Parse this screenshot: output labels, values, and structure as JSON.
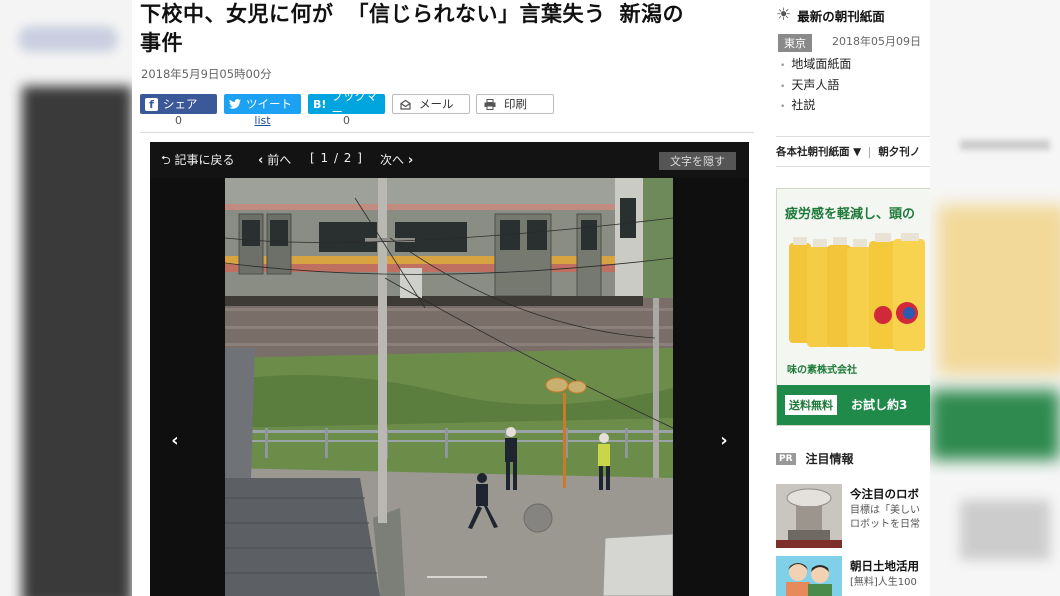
{
  "article": {
    "headline_part1": "下校中、女児に何が",
    "headline_part2": "「信じられない」言葉失う",
    "headline_part3": "新潟の",
    "headline_line2": "事件",
    "dateline": "2018年5月9日05時00分"
  },
  "share": {
    "facebook": {
      "icon": "f",
      "label": "シェア",
      "count": "0"
    },
    "twitter": {
      "label": "ツイート",
      "count": "list"
    },
    "hatena": {
      "icon": "B!",
      "label": "ブックマー",
      "count": "0"
    },
    "mail": {
      "label": "メール"
    },
    "print": {
      "label": "印刷"
    }
  },
  "viewer": {
    "back_label": "記事に戻る",
    "prev_label": "前へ",
    "page_indicator": "[ 1 / 2 ]",
    "next_label": "次へ",
    "hide_text_label": "文字を隠す"
  },
  "sidebar": {
    "section_title": "最新の朝刊紙面",
    "city": "東京",
    "date": "2018年05月09日 ",
    "links": [
      "地域面紙面",
      "天声人語",
      "社説"
    ],
    "tabs": [
      "各本社朝刊紙面",
      "朝夕刊ノ"
    ],
    "ad": {
      "headline": "疲労感を軽減し、頭の",
      "maker": "味の素株式会社",
      "free_badge": "送料無料",
      "cta": "お試し約3"
    },
    "pr_badge": "PR",
    "pr_title": "注目情報",
    "news": [
      {
        "title": "今注目のロボ",
        "lines": [
          "目標は「美しい",
          "ロボットを日常"
        ]
      },
      {
        "title": "朝日土地活用",
        "lines": [
          "[無料]人生100",
          ""
        ]
      }
    ]
  },
  "colors": {
    "facebook": "#3b5998",
    "twitter": "#1da1f2",
    "hatena": "#00a4de",
    "ad_green": "#1f8a4a"
  }
}
